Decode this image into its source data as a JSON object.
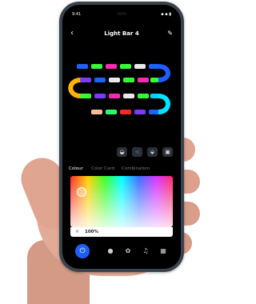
{
  "status": {
    "time": "9:41",
    "indicators": "▪ ▪ ▮"
  },
  "header": {
    "back_label": "‹",
    "title": "Light Bar 4",
    "edit_label": "✎"
  },
  "strip": {
    "lane_colors": [
      "#1e63ff",
      "#35ff36",
      "#ff2ab6",
      "#e9e9e9",
      "#ff2a2a",
      "#ffbd2a",
      "#00d2ff",
      "#7c3cff"
    ],
    "accent_colors": {
      "blue": "#1e5eff",
      "orange": "#ffb300",
      "cyan": "#00e5ff",
      "green": "#29ff6a"
    }
  },
  "tools": [
    {
      "icon": "theme-icon",
      "glyph": "◒"
    },
    {
      "icon": "share-icon",
      "glyph": "≺"
    },
    {
      "icon": "eraser-icon",
      "glyph": "⬙"
    },
    {
      "icon": "save-icon",
      "glyph": "▣"
    }
  ],
  "tabs": {
    "tab1": "Colour",
    "tab2": "Color Card",
    "tab3": "Combination"
  },
  "picker": {
    "brightness_value": "100%",
    "brightness_icon": "☼"
  },
  "bottom_nav": {
    "power_glyph": "⏻",
    "items": [
      {
        "icon": "light-icon",
        "glyph": "●"
      },
      {
        "icon": "palette-icon",
        "glyph": "✿"
      },
      {
        "icon": "music-icon",
        "glyph": "♫"
      },
      {
        "icon": "grid-icon",
        "glyph": "▦"
      }
    ]
  }
}
